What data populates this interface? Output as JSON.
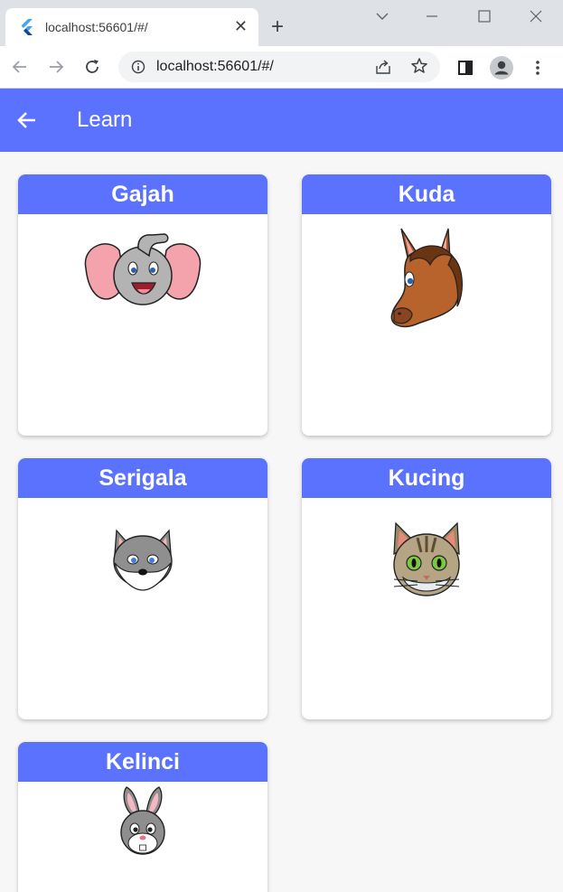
{
  "browser": {
    "tab_title": "localhost:56601/#/",
    "url": "localhost:56601/#/",
    "new_tab_label": "+",
    "close_tab_label": "✕"
  },
  "app": {
    "title": "Learn",
    "accent_color": "#5b72ff"
  },
  "cards": [
    {
      "label": "Gajah",
      "icon": "elephant-icon"
    },
    {
      "label": "Kuda",
      "icon": "horse-icon"
    },
    {
      "label": "Serigala",
      "icon": "wolf-icon"
    },
    {
      "label": "Kucing",
      "icon": "cat-icon"
    },
    {
      "label": "Kelinci",
      "icon": "rabbit-icon"
    }
  ]
}
